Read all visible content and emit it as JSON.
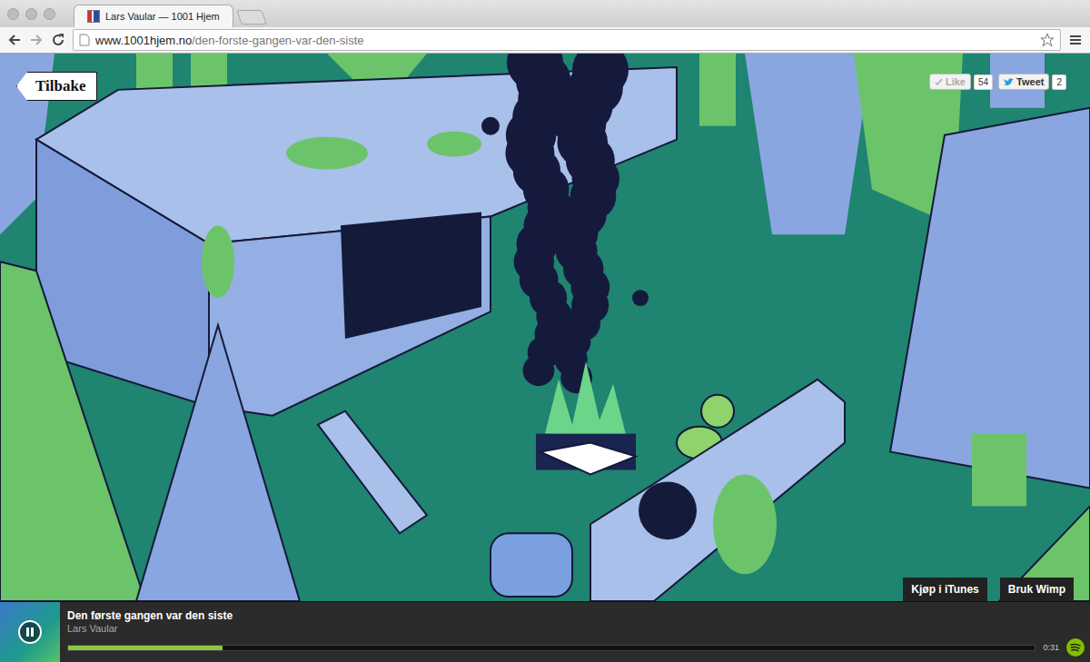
{
  "window": {
    "title": "Lars Vaular — 1001 Hjem"
  },
  "tabs": [
    {
      "label": "Lars Vaular — 1001 Hjem",
      "selected": true
    }
  ],
  "address_bar": {
    "host": "www.1001hjem.no",
    "path": "/den-forste-gangen-var-den-siste"
  },
  "back_button": {
    "label": "Tilbake"
  },
  "social": [
    {
      "label": "Like",
      "count": "54"
    },
    {
      "label": "Tweet",
      "count": "2"
    }
  ],
  "store_buttons": [
    "Kjøp i iTunes",
    "Bruk Wimp"
  ],
  "player": {
    "track": "Den første gangen var den siste",
    "artist": "Lars Vaular",
    "playing": true,
    "level": 0.16,
    "time": "0:31"
  }
}
